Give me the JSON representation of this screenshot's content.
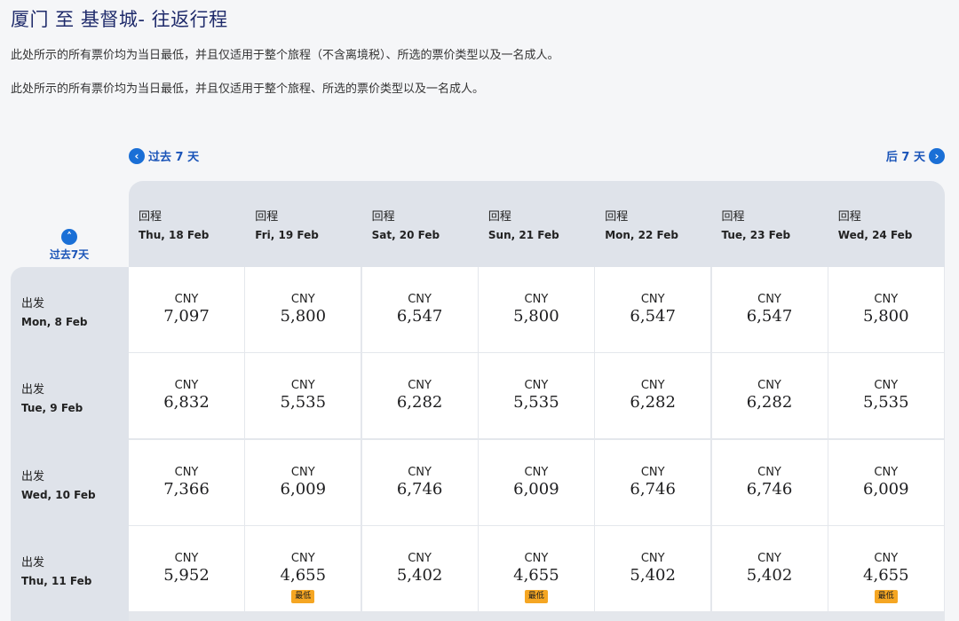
{
  "header": {
    "title": "厦门 至 基督城- 往返行程",
    "note1": "此处所示的所有票价均为当日最低，并且仅适用于整个旅程（不含离境税）、所选的票价类型以及一名成人。",
    "note2": "此处所示的所有票价均为当日最低，并且仅适用于整个旅程、所选的票价类型以及一名成人。"
  },
  "nav": {
    "prev_label": "过去 7 天",
    "next_label": "后 7 天",
    "prev_icon": "chevron-left-icon",
    "next_icon": "chevron-right-icon",
    "prev_week_up_label": "过去7天",
    "up_icon": "chevron-up-icon"
  },
  "columns": [
    {
      "label": "回程",
      "date": "Thu, 18 Feb"
    },
    {
      "label": "回程",
      "date": "Fri, 19 Feb"
    },
    {
      "label": "回程",
      "date": "Sat, 20 Feb"
    },
    {
      "label": "回程",
      "date": "Sun, 21 Feb"
    },
    {
      "label": "回程",
      "date": "Mon, 22 Feb"
    },
    {
      "label": "回程",
      "date": "Tue, 23 Feb"
    },
    {
      "label": "回程",
      "date": "Wed, 24 Feb"
    }
  ],
  "rows": [
    {
      "label": "出发",
      "date": "Mon, 8 Feb",
      "cells": [
        {
          "currency": "CNY",
          "price": "7,097"
        },
        {
          "currency": "CNY",
          "price": "5,800"
        },
        {
          "currency": "CNY",
          "price": "6,547"
        },
        {
          "currency": "CNY",
          "price": "5,800"
        },
        {
          "currency": "CNY",
          "price": "6,547"
        },
        {
          "currency": "CNY",
          "price": "6,547"
        },
        {
          "currency": "CNY",
          "price": "5,800"
        }
      ]
    },
    {
      "label": "出发",
      "date": "Tue, 9 Feb",
      "cells": [
        {
          "currency": "CNY",
          "price": "6,832"
        },
        {
          "currency": "CNY",
          "price": "5,535"
        },
        {
          "currency": "CNY",
          "price": "6,282"
        },
        {
          "currency": "CNY",
          "price": "5,535"
        },
        {
          "currency": "CNY",
          "price": "6,282"
        },
        {
          "currency": "CNY",
          "price": "6,282"
        },
        {
          "currency": "CNY",
          "price": "5,535"
        }
      ]
    },
    {
      "label": "出发",
      "date": "Wed, 10 Feb",
      "cells": [
        {
          "currency": "CNY",
          "price": "7,366"
        },
        {
          "currency": "CNY",
          "price": "6,009"
        },
        {
          "currency": "CNY",
          "price": "6,746"
        },
        {
          "currency": "CNY",
          "price": "6,009"
        },
        {
          "currency": "CNY",
          "price": "6,746"
        },
        {
          "currency": "CNY",
          "price": "6,746"
        },
        {
          "currency": "CNY",
          "price": "6,009"
        }
      ]
    },
    {
      "label": "出发",
      "date": "Thu, 11 Feb",
      "cells": [
        {
          "currency": "CNY",
          "price": "5,952"
        },
        {
          "currency": "CNY",
          "price": "4,655",
          "badge": "最低"
        },
        {
          "currency": "CNY",
          "price": "5,402"
        },
        {
          "currency": "CNY",
          "price": "4,655",
          "badge": "最低"
        },
        {
          "currency": "CNY",
          "price": "5,402"
        },
        {
          "currency": "CNY",
          "price": "5,402"
        },
        {
          "currency": "CNY",
          "price": "4,655",
          "badge": "最低"
        }
      ]
    }
  ],
  "colors": {
    "accent": "#1a6fd6",
    "title": "#1f2b6b",
    "header_bg": "#dfe3ea",
    "badge": "#f5a623"
  }
}
